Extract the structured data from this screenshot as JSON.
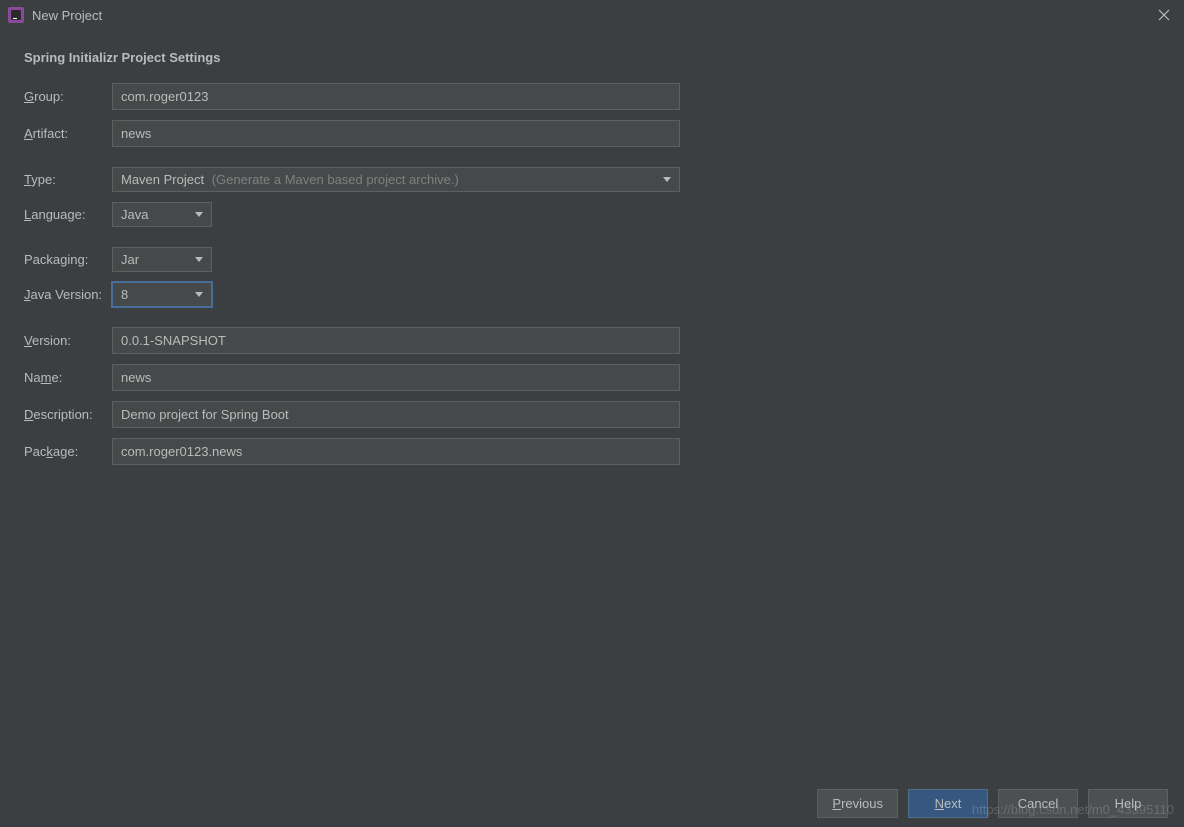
{
  "titlebar": {
    "title": "New Project"
  },
  "content": {
    "sectionTitle": "Spring Initializr Project Settings",
    "labels": {
      "group": "roup:",
      "artifact": "rtifact:",
      "type": "ype:",
      "language": "anguage:",
      "packaging": "Packaging:",
      "javaVersion": "ava Version:",
      "version": "ersion:",
      "name": "e:",
      "description": "escription:",
      "package": "age:"
    },
    "fields": {
      "group": "com.roger0123",
      "artifact": "news",
      "typeValue": "Maven Project",
      "typeHint": "(Generate a Maven based project archive.)",
      "language": "Java",
      "packaging": "Jar",
      "javaVersion": "8",
      "version": "0.0.1-SNAPSHOT",
      "name": "news",
      "description": "Demo project for Spring Boot",
      "package": "com.roger0123.news"
    }
  },
  "footer": {
    "previous": "revious",
    "next": "ext",
    "cancel": "Cancel",
    "help": "Help"
  },
  "watermark": "https://blog.csdn.net/m0_43395110"
}
